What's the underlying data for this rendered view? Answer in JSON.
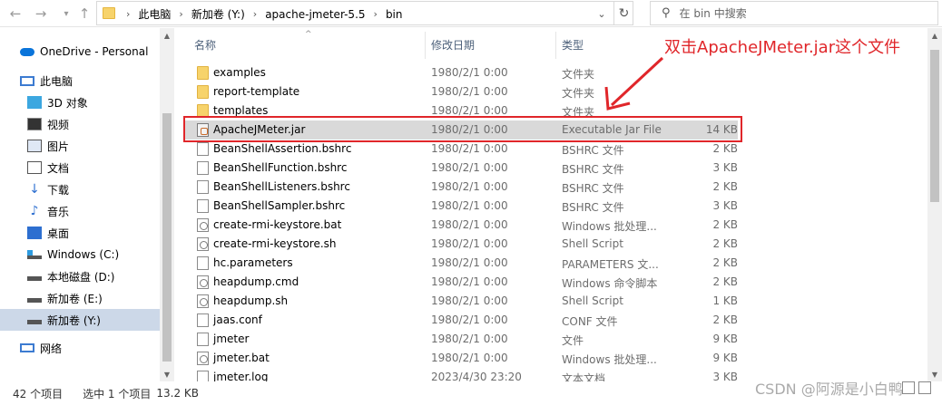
{
  "nav": {
    "back_icon": "back-arrow-icon",
    "forward_icon": "forward-arrow-icon",
    "recent_icon": "chevron-down-icon",
    "up_icon": "up-arrow-icon"
  },
  "address": {
    "crumbs": [
      "此电脑",
      "新加卷 (Y:)",
      "apache-jmeter-5.5",
      "bin"
    ]
  },
  "search": {
    "placeholder": "在 bin 中搜索"
  },
  "sidebar": {
    "items": [
      {
        "label": "OneDrive - Personal",
        "icon": "onedrive-cloud-icon"
      },
      {
        "label": "此电脑",
        "icon": "computer-icon"
      },
      {
        "label": "3D 对象",
        "icon": "3d-objects-icon"
      },
      {
        "label": "视频",
        "icon": "video-icon"
      },
      {
        "label": "图片",
        "icon": "pictures-icon"
      },
      {
        "label": "文档",
        "icon": "documents-icon"
      },
      {
        "label": "下载",
        "icon": "download-icon"
      },
      {
        "label": "音乐",
        "icon": "music-icon"
      },
      {
        "label": "桌面",
        "icon": "desktop-icon"
      },
      {
        "label": "Windows (C:)",
        "icon": "drive-c-icon"
      },
      {
        "label": "本地磁盘 (D:)",
        "icon": "drive-icon"
      },
      {
        "label": "新加卷 (E:)",
        "icon": "drive-icon"
      },
      {
        "label": "新加卷 (Y:)",
        "icon": "drive-icon"
      },
      {
        "label": "网络",
        "icon": "network-icon"
      }
    ]
  },
  "columns": {
    "name": "名称",
    "date": "修改日期",
    "type": "类型"
  },
  "files": [
    {
      "name": "examples",
      "date": "1980/2/1 0:00",
      "type": "文件夹",
      "size": "",
      "kind": "folder"
    },
    {
      "name": "report-template",
      "date": "1980/2/1 0:00",
      "type": "文件夹",
      "size": "",
      "kind": "folder"
    },
    {
      "name": "templates",
      "date": "1980/2/1 0:00",
      "type": "文件夹",
      "size": "",
      "kind": "folder"
    },
    {
      "name": "ApacheJMeter.jar",
      "date": "1980/2/1 0:00",
      "type": "Executable Jar File",
      "size": "14 KB",
      "kind": "jar"
    },
    {
      "name": "BeanShellAssertion.bshrc",
      "date": "1980/2/1 0:00",
      "type": "BSHRC 文件",
      "size": "2 KB",
      "kind": "file"
    },
    {
      "name": "BeanShellFunction.bshrc",
      "date": "1980/2/1 0:00",
      "type": "BSHRC 文件",
      "size": "3 KB",
      "kind": "file"
    },
    {
      "name": "BeanShellListeners.bshrc",
      "date": "1980/2/1 0:00",
      "type": "BSHRC 文件",
      "size": "2 KB",
      "kind": "file"
    },
    {
      "name": "BeanShellSampler.bshrc",
      "date": "1980/2/1 0:00",
      "type": "BSHRC 文件",
      "size": "3 KB",
      "kind": "file"
    },
    {
      "name": "create-rmi-keystore.bat",
      "date": "1980/2/1 0:00",
      "type": "Windows 批处理...",
      "size": "2 KB",
      "kind": "script"
    },
    {
      "name": "create-rmi-keystore.sh",
      "date": "1980/2/1 0:00",
      "type": "Shell Script",
      "size": "2 KB",
      "kind": "script"
    },
    {
      "name": "hc.parameters",
      "date": "1980/2/1 0:00",
      "type": "PARAMETERS 文...",
      "size": "2 KB",
      "kind": "file"
    },
    {
      "name": "heapdump.cmd",
      "date": "1980/2/1 0:00",
      "type": "Windows 命令脚本",
      "size": "2 KB",
      "kind": "script"
    },
    {
      "name": "heapdump.sh",
      "date": "1980/2/1 0:00",
      "type": "Shell Script",
      "size": "1 KB",
      "kind": "script"
    },
    {
      "name": "jaas.conf",
      "date": "1980/2/1 0:00",
      "type": "CONF 文件",
      "size": "2 KB",
      "kind": "file"
    },
    {
      "name": "jmeter",
      "date": "1980/2/1 0:00",
      "type": "文件",
      "size": "9 KB",
      "kind": "file"
    },
    {
      "name": "jmeter.bat",
      "date": "1980/2/1 0:00",
      "type": "Windows 批处理...",
      "size": "9 KB",
      "kind": "script"
    },
    {
      "name": "jmeter.log",
      "date": "2023/4/30 23:20",
      "type": "文本文档",
      "size": "3 KB",
      "kind": "file"
    }
  ],
  "status": {
    "count": "42 个项目",
    "selected": "选中 1 个项目",
    "size": "13.2 KB"
  },
  "annotation": {
    "text": "双击ApacheJMeter.jar这个文件",
    "color": "#e0262a"
  },
  "watermark": "CSDN @阿源是小白鸭"
}
